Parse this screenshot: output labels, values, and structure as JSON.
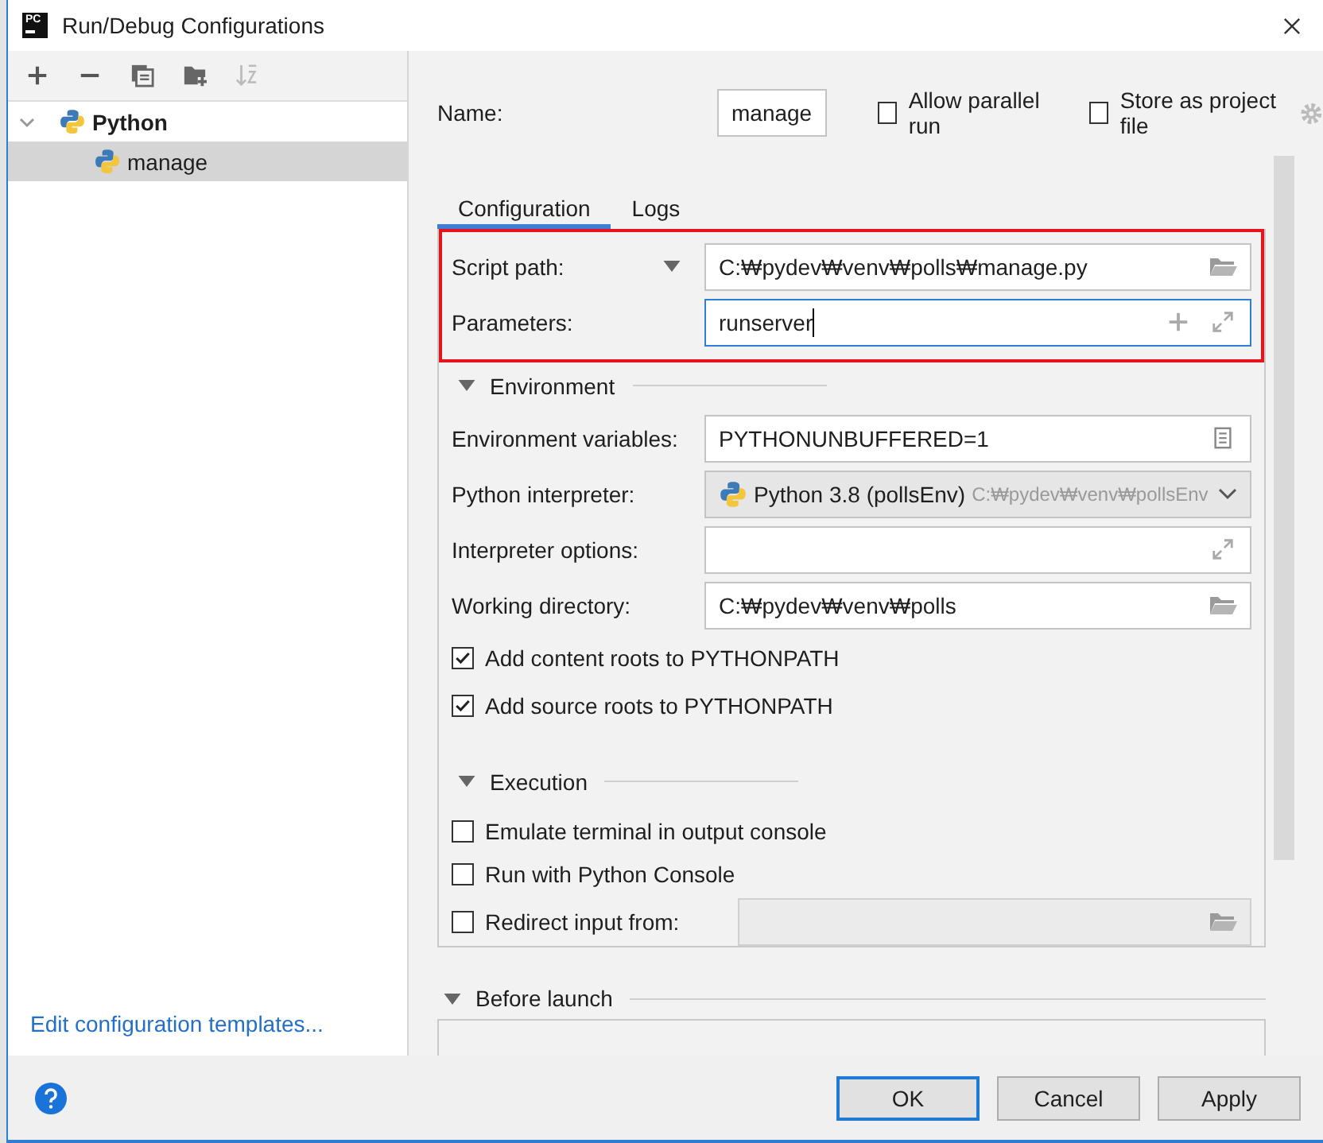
{
  "window": {
    "title": "Run/Debug Configurations",
    "app_icon": "PC"
  },
  "tree": [
    {
      "label": "Python",
      "expanded": true,
      "selected": false,
      "children": [
        {
          "label": "manage",
          "selected": true
        }
      ]
    }
  ],
  "templates_link": "Edit configuration templates...",
  "name": {
    "label": "Name:",
    "value": "manage"
  },
  "options": [
    {
      "label": "Allow parallel run",
      "checked": false
    },
    {
      "label": "Store as project file",
      "checked": false
    }
  ],
  "tabs": [
    {
      "label": "Configuration",
      "selected": true
    },
    {
      "label": "Logs",
      "selected": false
    }
  ],
  "script_group": {
    "highlighted": true,
    "rows": [
      {
        "kind": "script",
        "label": "Script path:",
        "value": "C:₩pydev₩venv₩polls₩manage.py",
        "focused": false
      },
      {
        "kind": "arguments",
        "label": "Parameters:",
        "value": "runserver",
        "focused": true
      }
    ]
  },
  "sections": [
    {
      "title": "Environment",
      "expanded": true,
      "rows": [
        {
          "kind": "variables",
          "label": "Environment variables:",
          "value": "PYTHONUNBUFFERED=1",
          "focused": false
        },
        {
          "kind": "interpreter",
          "label": "Python interpreter:",
          "value": "Python 3.8 (pollsEnv)",
          "detail": "C:₩pydev₩venv₩pollsEnv",
          "focused": false
        },
        {
          "kind": "options",
          "label": "Interpreter options:",
          "focused": false
        },
        {
          "kind": "directory",
          "label": "Working directory:",
          "value": "C:₩pydev₩venv₩polls",
          "focused": false
        }
      ],
      "checkboxes": [
        {
          "kind": "plain",
          "label": "Add content roots to PYTHONPATH",
          "checked": true
        },
        {
          "kind": "plain",
          "label": "Add source roots to PYTHONPATH",
          "checked": true
        }
      ]
    },
    {
      "title": "Execution",
      "expanded": true,
      "checkboxes": [
        {
          "kind": "plain",
          "label": "Emulate terminal in output console",
          "checked": false
        },
        {
          "kind": "plain",
          "label": "Run with Python Console",
          "checked": false
        },
        {
          "kind": "with-field",
          "label": "Redirect input from:",
          "checked": false
        }
      ]
    }
  ],
  "before_launch": {
    "title": "Before launch",
    "expanded": true
  },
  "buttons": [
    {
      "label": "OK",
      "default": true
    },
    {
      "label": "Cancel",
      "default": false
    },
    {
      "label": "Apply",
      "default": false
    }
  ]
}
